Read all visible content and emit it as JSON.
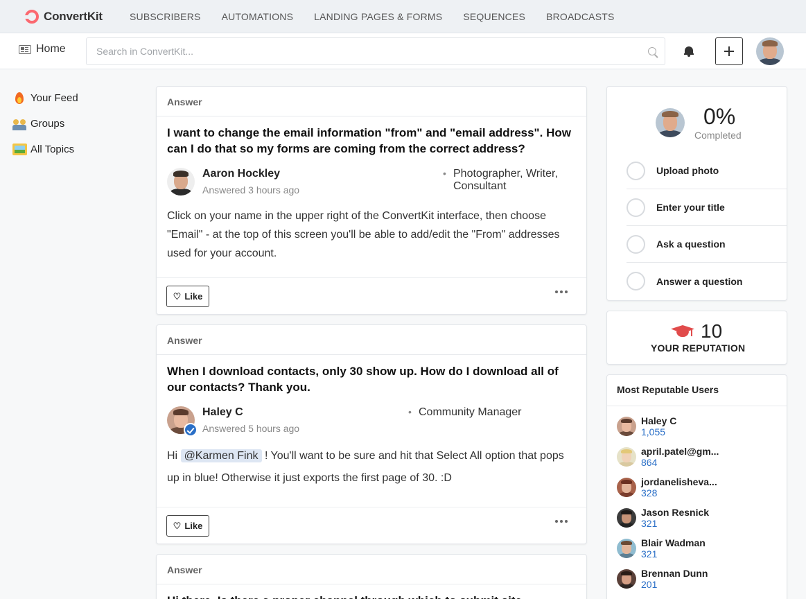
{
  "brand": {
    "name": "ConvertKit",
    "color": "#fb6970"
  },
  "topnav": [
    "SUBSCRIBERS",
    "AUTOMATIONS",
    "LANDING PAGES & FORMS",
    "SEQUENCES",
    "BROADCASTS"
  ],
  "subbar": {
    "home_label": "Home",
    "search_placeholder": "Search in ConvertKit..."
  },
  "leftnav": [
    {
      "label": "Your Feed",
      "icon": "fire-icon"
    },
    {
      "label": "Groups",
      "icon": "groups-icon"
    },
    {
      "label": "All Topics",
      "icon": "picture-icon"
    }
  ],
  "feed": [
    {
      "type_label": "Answer",
      "title": "I want to change the email information \"from\" and \"email address\". How can I do that so my forms are coming from the correct address?",
      "author": "Aaron Hockley",
      "role": "Photographer, Writer, Consultant",
      "time": "Answered 3 hours ago",
      "body": "Click on your name in the upper right of the ConvertKit interface, then choose \"Email\" - at the top of this screen you'll be able to add/edit the \"From\" addresses used for your account.",
      "like_label": "Like"
    },
    {
      "type_label": "Answer",
      "title": "When I download contacts, only 30 show up. How do I download all of our contacts? Thank you.",
      "author": "Haley C",
      "role": "Community Manager",
      "time": "Answered 5 hours ago",
      "body_pre": "Hi ",
      "mention": "@Karmen Fink",
      "body_post": " ! You'll want to be sure and hit that Select All option that pops up in blue! Otherwise it just exports the first page of 30. :D",
      "like_label": "Like"
    },
    {
      "type_label": "Answer",
      "title": "Hi there, Is there a proper channel through which to submit site"
    }
  ],
  "progress": {
    "percent_label": "0%",
    "completed_label": "Completed",
    "tasks": [
      "Upload photo",
      "Enter your title",
      "Ask a question",
      "Answer a question"
    ]
  },
  "reputation": {
    "value": "10",
    "label": "YOUR REPUTATION",
    "accent": "#e14b4b"
  },
  "top_users": {
    "heading": "Most Reputable Users",
    "users": [
      {
        "name": "Haley C",
        "score": "1,055"
      },
      {
        "name": "april.patel@gm...",
        "score": "864"
      },
      {
        "name": "jordanelisheva...",
        "score": "328"
      },
      {
        "name": "Jason Resnick",
        "score": "321"
      },
      {
        "name": "Blair Wadman",
        "score": "321"
      },
      {
        "name": "Brennan Dunn",
        "score": "201"
      }
    ]
  }
}
